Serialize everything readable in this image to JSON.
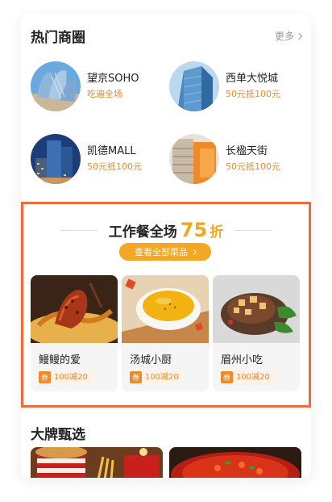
{
  "hot_districts": {
    "title": "热门商圈",
    "more_label": "更多",
    "items": [
      {
        "name": "望京SOHO",
        "deal": "吃遍全场"
      },
      {
        "name": "西单大悦城",
        "deal": "50元抵100元"
      },
      {
        "name": "凯德MALL",
        "deal": "50元抵100元"
      },
      {
        "name": "长楹天街",
        "deal": "50元抵100元"
      }
    ]
  },
  "promo": {
    "title_prefix": "工作餐全场",
    "discount": "75",
    "discount_suffix": "折",
    "view_all_label": "查看全部菜品",
    "dishes": [
      {
        "name": "鳗鳗的爱",
        "coupon_tag": "券",
        "coupon": "100减20"
      },
      {
        "name": "汤城小厨",
        "coupon_tag": "券",
        "coupon": "100减20"
      },
      {
        "name": "眉州小吃",
        "coupon_tag": "券",
        "coupon": "100减20"
      }
    ]
  },
  "brands": {
    "title": "大牌甄选"
  },
  "colors": {
    "accent": "#f5a623",
    "deal_text": "#f08a28",
    "promo_border": "#f06a3a"
  }
}
